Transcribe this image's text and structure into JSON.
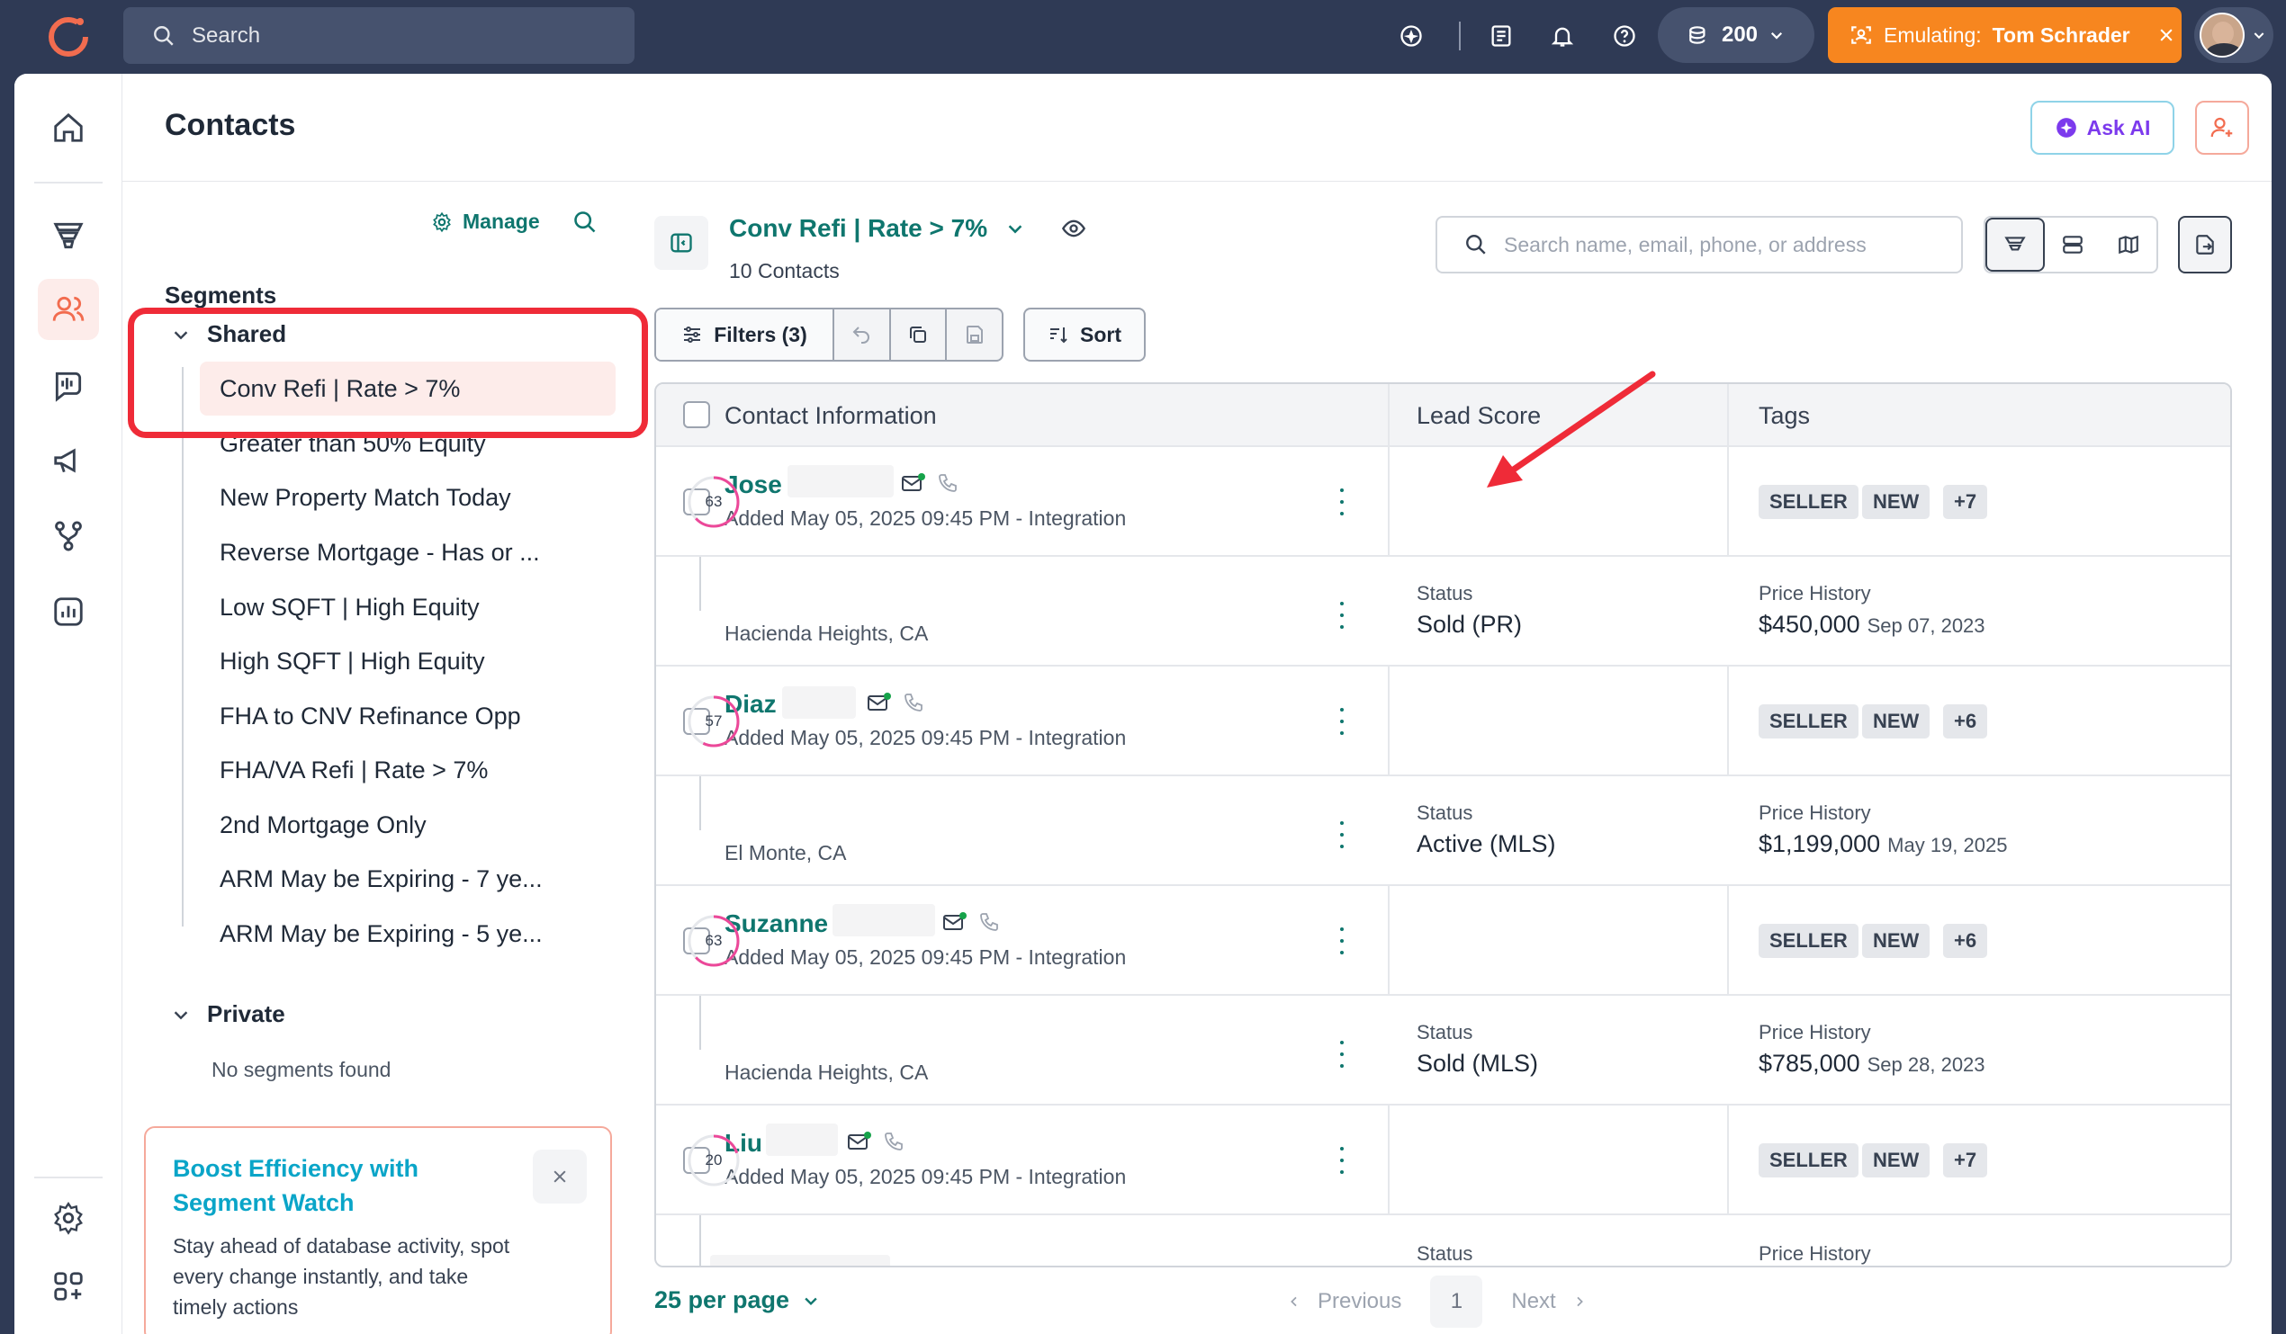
{
  "topbar": {
    "search_placeholder": "Search",
    "credits": "200",
    "emulating_label": "Emulating:",
    "emulating_user": "Tom Schrader"
  },
  "header": {
    "title": "Contacts",
    "ask_ai": "Ask AI"
  },
  "segments": {
    "title": "Segments",
    "manage": "Manage",
    "shared_label": "Shared",
    "items": [
      "Conv Refi | Rate > 7%",
      "Greater than 50% Equity",
      "New Property Match Today",
      "Reverse Mortgage - Has or ...",
      "Low SQFT | High Equity",
      "High SQFT | High Equity",
      "FHA to CNV Refinance Opp",
      "FHA/VA Refi | Rate > 7%",
      "2nd Mortgage Only",
      "ARM May be Expiring - 7 ye...",
      "ARM May be Expiring - 5 ye..."
    ],
    "private_label": "Private",
    "no_segments": "No segments found",
    "promo_title": "Boost Efficiency with Segment Watch",
    "promo_text": "Stay ahead of database activity, spot every change instantly, and take timely actions"
  },
  "current_segment": {
    "name": "Conv Refi | Rate > 7%",
    "count": "10 Contacts",
    "search_placeholder": "Search name, email, phone, or address"
  },
  "toolbar": {
    "filters": "Filters (3)",
    "sort": "Sort"
  },
  "table": {
    "headers": [
      "Contact Information",
      "Lead Score",
      "Tags"
    ],
    "status_label": "Status",
    "price_label": "Price History",
    "rows": [
      {
        "name": "Jose",
        "added": "Added May 05, 2025 09:45 PM - Integration",
        "score": 63,
        "tags": [
          "SELLER",
          "NEW",
          "+7"
        ],
        "location": "Hacienda Heights, CA",
        "status": "Sold (PR)",
        "price": "$450,000",
        "price_date": "Sep 07, 2023"
      },
      {
        "name": "Diaz",
        "added": "Added May 05, 2025 09:45 PM - Integration",
        "score": 57,
        "tags": [
          "SELLER",
          "NEW",
          "+6"
        ],
        "location": "El Monte, CA",
        "status": "Active (MLS)",
        "price": "$1,199,000",
        "price_date": "May 19, 2025"
      },
      {
        "name": "Suzanne",
        "added": "Added May 05, 2025 09:45 PM - Integration",
        "score": 63,
        "tags": [
          "SELLER",
          "NEW",
          "+6"
        ],
        "location": "Hacienda Heights, CA",
        "status": "Sold (MLS)",
        "price": "$785,000",
        "price_date": "Sep 28, 2023"
      },
      {
        "name": "Liu",
        "added": "Added May 05, 2025 09:45 PM - Integration",
        "score": 20,
        "tags": [
          "SELLER",
          "NEW",
          "+7"
        ],
        "location": "",
        "status": "",
        "price": "",
        "price_date": ""
      }
    ]
  },
  "pagination": {
    "per_page": "25 per page",
    "previous": "Previous",
    "page": "1",
    "next": "Next"
  },
  "colors": {
    "accent": "#0f766e",
    "brand": "#f7861f",
    "highlight": "#ef2b38",
    "nav_bg": "#2f3a55"
  }
}
